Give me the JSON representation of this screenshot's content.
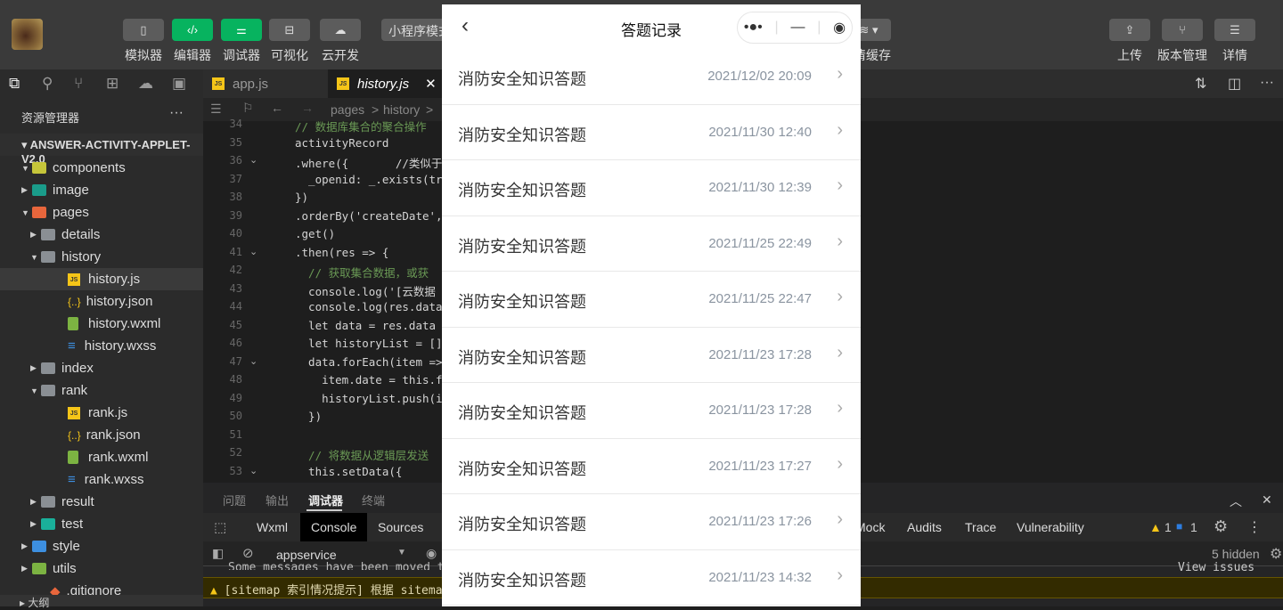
{
  "toolbar": {
    "buttons": [
      {
        "label": "模拟器",
        "icon": "phone-icon"
      },
      {
        "label": "编辑器",
        "icon": "code-icon"
      },
      {
        "label": "调试器",
        "icon": "sliders-icon"
      },
      {
        "label": "可视化",
        "icon": "layout-icon"
      },
      {
        "label": "云开发",
        "icon": "cloud-icon"
      }
    ],
    "mode": "小程序模式",
    "cache_label": "清缓存",
    "right_buttons": [
      {
        "label": "上传"
      },
      {
        "label": "版本管理"
      },
      {
        "label": "详情"
      }
    ]
  },
  "sidebar": {
    "title": "资源管理器",
    "more": "···",
    "project": "ANSWER-ACTIVITY-APPLET-V2.0",
    "tree": [
      {
        "name": "components",
        "color": "#c5c53a",
        "arrow": "▼",
        "depth": 0
      },
      {
        "name": "image",
        "color": "#1a9c8a",
        "arrow": "▶",
        "depth": 0
      },
      {
        "name": "pages",
        "color": "#e8663c",
        "arrow": "▼",
        "depth": 0
      },
      {
        "name": "details",
        "color": "#8a8f94",
        "arrow": "▶",
        "depth": 1
      },
      {
        "name": "history",
        "color": "#8a8f94",
        "arrow": "▼",
        "depth": 1
      },
      {
        "name": "history.js",
        "type": "js",
        "depth": 2,
        "selected": true
      },
      {
        "name": "history.json",
        "type": "json",
        "depth": 2
      },
      {
        "name": "history.wxml",
        "type": "wxml",
        "depth": 2
      },
      {
        "name": "history.wxss",
        "type": "wxss",
        "depth": 2
      },
      {
        "name": "index",
        "color": "#8a8f94",
        "arrow": "▶",
        "depth": 1
      },
      {
        "name": "rank",
        "color": "#8a8f94",
        "arrow": "▼",
        "depth": 1
      },
      {
        "name": "rank.js",
        "type": "js",
        "depth": 2
      },
      {
        "name": "rank.json",
        "type": "json",
        "depth": 2
      },
      {
        "name": "rank.wxml",
        "type": "wxml",
        "depth": 2
      },
      {
        "name": "rank.wxss",
        "type": "wxss",
        "depth": 2
      },
      {
        "name": "result",
        "color": "#8a8f94",
        "arrow": "▶",
        "depth": 1
      },
      {
        "name": "test",
        "color": "#1ab09a",
        "arrow": "▶",
        "depth": 1
      },
      {
        "name": "style",
        "color": "#3d8fe0",
        "arrow": "▶",
        "depth": 0
      },
      {
        "name": "utils",
        "color": "#7cb342",
        "arrow": "▶",
        "depth": 0
      },
      {
        "name": ".gitignore",
        "type": "git",
        "depth": 0
      }
    ]
  },
  "editor": {
    "tabs": [
      {
        "label": "app.js"
      },
      {
        "label": "history.js",
        "active": true
      }
    ],
    "breadcrumb": [
      "pages",
      ">",
      "history",
      ">"
    ],
    "lines": [
      {
        "n": "34",
        "t": "// 数据库集合的聚合操作"
      },
      {
        "n": "35",
        "t": "activityRecord"
      },
      {
        "n": "36",
        "t": ".where({       //类似于"
      },
      {
        "n": "37",
        "t": "  _openid: _.exists(tr"
      },
      {
        "n": "38",
        "t": "})"
      },
      {
        "n": "39",
        "t": ".orderBy('createDate',"
      },
      {
        "n": "40",
        "t": ".get()"
      },
      {
        "n": "41",
        "t": ".then(res => {"
      },
      {
        "n": "42",
        "t": "  // 获取集合数据，或获"
      },
      {
        "n": "43",
        "t": "  console.log('[云数据"
      },
      {
        "n": "44",
        "t": "  console.log(res.data"
      },
      {
        "n": "45",
        "t": "  let data = res.data"
      },
      {
        "n": "46",
        "t": "  let historyList = []"
      },
      {
        "n": "47",
        "t": "  data.forEach(item =>"
      },
      {
        "n": "48",
        "t": "    item.date = this.f"
      },
      {
        "n": "49",
        "t": "    historyList.push(i"
      },
      {
        "n": "50",
        "t": "  })"
      },
      {
        "n": "51",
        "t": ""
      },
      {
        "n": "52",
        "t": "  // 将数据从逻辑层发送"
      },
      {
        "n": "53",
        "t": "  this.setData({"
      }
    ]
  },
  "panel": {
    "tabs": [
      "问题",
      "输出",
      "调试器",
      "终端"
    ],
    "devtools_tabs": [
      "Wxml",
      "Console",
      "Sources"
    ],
    "devtools_tabs_right": [
      "Mock",
      "Audits",
      "Trace",
      "Vulnerability"
    ],
    "warn_count": "1",
    "info_count": "1",
    "context": "appservice",
    "hidden": "5 hidden",
    "messages": [
      "Some messages have been moved to",
      "View issues"
    ],
    "warning": "[sitemap 索引情况提示] 根据 sitemap"
  },
  "phone": {
    "title": "答题记录",
    "records": [
      {
        "title": "消防安全知识答题",
        "date": "2021/12/02 20:09"
      },
      {
        "title": "消防安全知识答题",
        "date": "2021/11/30 12:40"
      },
      {
        "title": "消防安全知识答题",
        "date": "2021/11/30 12:39"
      },
      {
        "title": "消防安全知识答题",
        "date": "2021/11/25 22:49"
      },
      {
        "title": "消防安全知识答题",
        "date": "2021/11/25 22:47"
      },
      {
        "title": "消防安全知识答题",
        "date": "2021/11/23 17:28"
      },
      {
        "title": "消防安全知识答题",
        "date": "2021/11/23 17:28"
      },
      {
        "title": "消防安全知识答题",
        "date": "2021/11/23 17:27"
      },
      {
        "title": "消防安全知识答题",
        "date": "2021/11/23 17:26"
      },
      {
        "title": "消防安全知识答题",
        "date": "2021/11/23 14:32"
      }
    ]
  }
}
